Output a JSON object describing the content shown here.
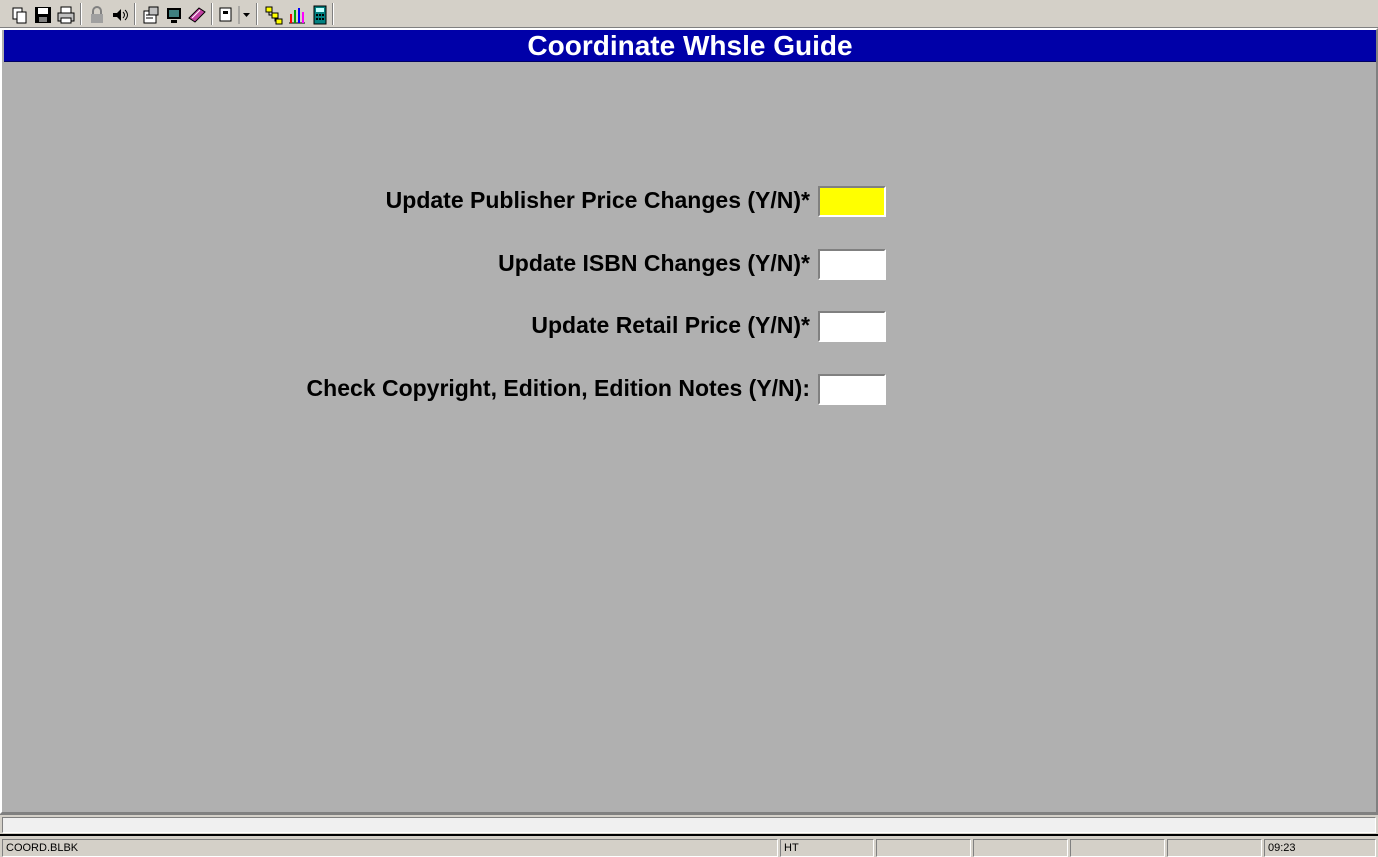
{
  "toolbar": {
    "buttons": [
      {
        "name": "copy-icon"
      },
      {
        "name": "save-icon"
      },
      {
        "name": "print-icon"
      },
      {
        "name": "lock-icon"
      },
      {
        "name": "audio-icon"
      },
      {
        "name": "properties-icon"
      },
      {
        "name": "monitor-icon"
      },
      {
        "name": "book-icon"
      },
      {
        "name": "window-dropdown-icon"
      },
      {
        "name": "hierarchy-icon"
      },
      {
        "name": "bar-chart-icon"
      },
      {
        "name": "calculator-icon"
      }
    ]
  },
  "form": {
    "title": "Coordinate Whsle Guide",
    "fields": [
      {
        "label": "Update Publisher Price Changes (Y/N)*",
        "value": ""
      },
      {
        "label": "Update ISBN Changes (Y/N)*",
        "value": ""
      },
      {
        "label": "Update Retail Price (Y/N)*",
        "value": ""
      },
      {
        "label": "Check Copyright, Edition, Edition Notes (Y/N):",
        "value": ""
      }
    ]
  },
  "message_line": "",
  "statusbar": {
    "program": "COORD.BLBK",
    "mode": "HT",
    "cell3": "",
    "cell4": "",
    "cell5": "",
    "cell6": "",
    "time": "09:23"
  },
  "colors": {
    "title_bg": "#0000a8",
    "form_bg": "#b0b0b0",
    "active_field": "#ffff00"
  }
}
